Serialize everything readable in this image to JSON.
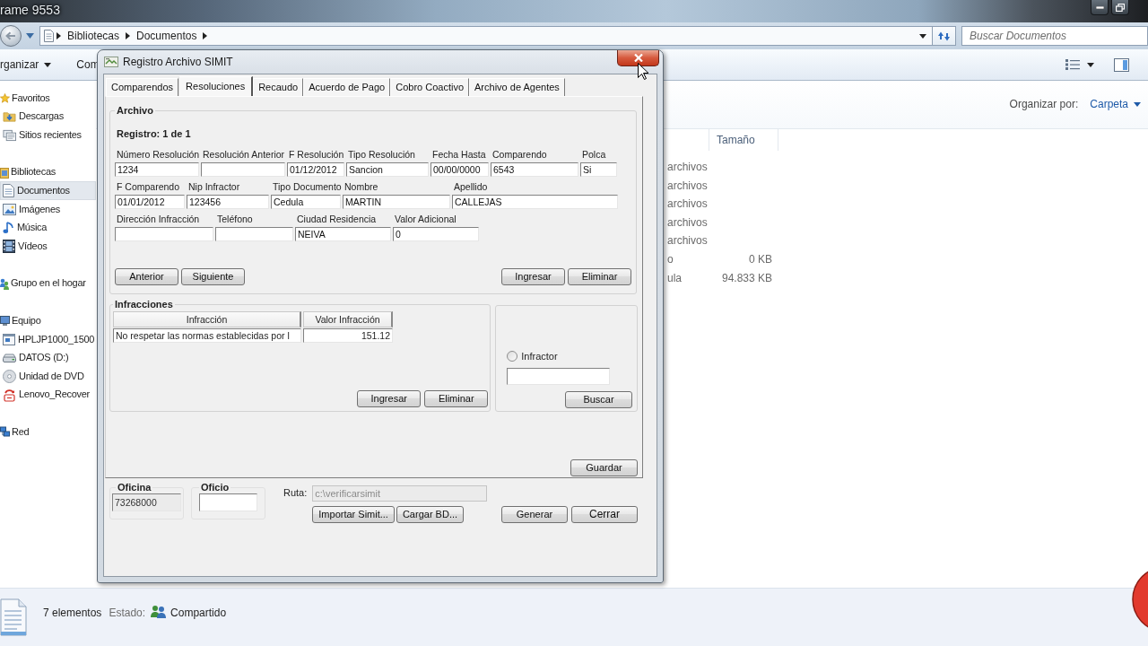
{
  "explorer": {
    "title": "rame 9553",
    "address": {
      "crumbs": [
        "Bibliotecas",
        "Documentos"
      ]
    },
    "search": {
      "placeholder": "Buscar Documentos"
    },
    "toolbar": [
      {
        "label": "rganizar",
        "dropdown": true
      },
      {
        "label": "Com",
        "dropdown": false
      }
    ],
    "arrange": {
      "label": "Organizar por:",
      "value": "Carpeta"
    },
    "nav": [
      {
        "label": "Favoritos",
        "selected": false,
        "children": [
          {
            "label": "Descargas",
            "selected": false
          },
          {
            "label": "Sitios recientes",
            "selected": false
          }
        ]
      },
      {
        "label": "Bibliotecas",
        "selected": false,
        "children": [
          {
            "label": "Documentos",
            "selected": true
          },
          {
            "label": "Imágenes",
            "selected": false
          },
          {
            "label": "Música",
            "selected": false
          },
          {
            "label": "Vídeos",
            "selected": false
          }
        ]
      },
      {
        "label": "Grupo en el hogar",
        "selected": false
      },
      {
        "label": "Equipo",
        "selected": false,
        "children": [
          {
            "label": "HPLJP1000_1500",
            "selected": false
          },
          {
            "label": "DATOS (D:)",
            "selected": false
          },
          {
            "label": "Unidad de DVD",
            "selected": false
          },
          {
            "label": "Lenovo_Recover",
            "selected": false
          }
        ]
      },
      {
        "label": "Red",
        "selected": false
      }
    ],
    "list": {
      "columns": [
        "Tamaño"
      ],
      "rows": [
        {
          "column_1": "archivos"
        },
        {
          "column_1": "archivos"
        },
        {
          "column_1": "archivos"
        },
        {
          "column_1": "archivos"
        },
        {
          "column_1": "archivos"
        },
        {
          "column_1": "o",
          "size": "0 KB"
        },
        {
          "column_1": "ula",
          "size": "94.833 KB"
        }
      ]
    },
    "status_bar": {
      "count": "7 elementos",
      "state_label": "Estado:",
      "state": "Compartido"
    }
  },
  "dialog": {
    "title": "Registro Archivo SIMIT",
    "tabs": [
      {
        "label": "Comparendos",
        "selected": false
      },
      {
        "label": "Resoluciones",
        "selected": true
      },
      {
        "label": "Recaudo",
        "selected": false
      },
      {
        "label": "Acuerdo de Pago",
        "selected": false
      },
      {
        "label": "Cobro Coactivo",
        "selected": false
      },
      {
        "label": "Archivo de Agentes",
        "selected": false
      }
    ],
    "archivo": {
      "legend": "Archivo",
      "record": "Registro: 1 de 1",
      "rows": [
        [
          {
            "label": "Número Resolución",
            "value": "1234"
          },
          {
            "label": "Resolución Anterior"
          },
          {
            "label": "F Resolución",
            "value": "01/12/2012"
          },
          {
            "label": "Tipo Resolución",
            "value": "Sancion"
          },
          {
            "label": "Fecha Hasta",
            "value": "00/00/0000"
          },
          {
            "label": "Comparendo",
            "value": "6543"
          },
          {
            "label": "Polca",
            "value": "Si"
          }
        ],
        [
          {
            "label": "F Comparendo",
            "value": "01/01/2012"
          },
          {
            "label": "Nip Infractor",
            "value": "123456"
          },
          {
            "label": "Tipo Documento",
            "value": "Cedula"
          },
          {
            "label": "Nombre",
            "value": "MARTIN"
          },
          {
            "label": "Apellido",
            "value": "CALLEJAS"
          }
        ],
        [
          {
            "label": "Dirección Infracción"
          },
          {
            "label": "Teléfono"
          },
          {
            "label": "Ciudad Residencia",
            "value": "NEIVA"
          },
          {
            "label": "Valor Adicional",
            "value": "0"
          }
        ]
      ],
      "nav_buttons": [
        "Anterior",
        "Siguiente"
      ],
      "edit_buttons": [
        "Ingresar",
        "Eliminar"
      ]
    },
    "infracciones": {
      "legend": "Infracciones",
      "columns": [
        "Infracción",
        "Valor Infracción"
      ],
      "rows": [
        [
          "No respetar las normas establecidas por l",
          "151.12"
        ]
      ],
      "buttons": [
        "Ingresar",
        "Eliminar"
      ]
    },
    "search_panel": {
      "radio": {
        "label": "Infractor",
        "checked": false
      },
      "button": "Buscar"
    },
    "save_button": "Guardar",
    "oficina": {
      "legend": "Oficina",
      "value": "73268000",
      "readonly": true
    },
    "oficio": {
      "legend": "Oficio",
      "readonly": false
    },
    "ruta": {
      "label": "Ruta:",
      "value": "c:\\verificarsimit",
      "disabled": true
    },
    "file_buttons": [
      "Importar Simit...",
      "Cargar BD..."
    ],
    "action_buttons": [
      "Generar",
      "Cerrar"
    ]
  }
}
